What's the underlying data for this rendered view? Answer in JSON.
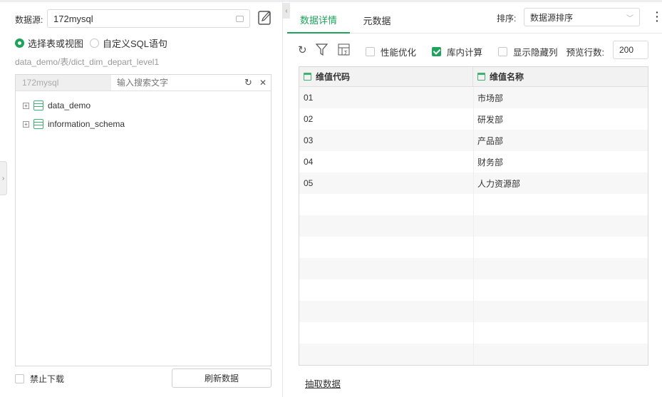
{
  "left": {
    "datasource_label": "数据源:",
    "datasource_value": "172mysql",
    "radio_table": "选择表或视图",
    "radio_sql": "自定义SQL语句",
    "path": "data_demo/表/dict_dim_depart_level1",
    "tree_source": "172mysql",
    "search_placeholder": "输入搜索文字",
    "tree_items": [
      {
        "label": "data_demo"
      },
      {
        "label": "information_schema"
      }
    ],
    "disable_download": "禁止下载",
    "refresh_button": "刷新数据"
  },
  "right": {
    "tabs": [
      {
        "label": "数据详情"
      },
      {
        "label": "元数据"
      }
    ],
    "sort_label": "排序:",
    "sort_value": "数据源排序",
    "perf_opt": "性能优化",
    "in_db_calc": "库内计算",
    "show_hidden": "显示隐藏列",
    "preview_rows_label": "预览行数:",
    "preview_rows_value": "200",
    "columns": [
      "维值代码",
      "维值名称"
    ],
    "rows": [
      [
        "01",
        "市场部"
      ],
      [
        "02",
        "研发部"
      ],
      [
        "03",
        "产品部"
      ],
      [
        "04",
        "财务部"
      ],
      [
        "05",
        "人力资源部"
      ]
    ],
    "extract_link": "抽取数据"
  }
}
